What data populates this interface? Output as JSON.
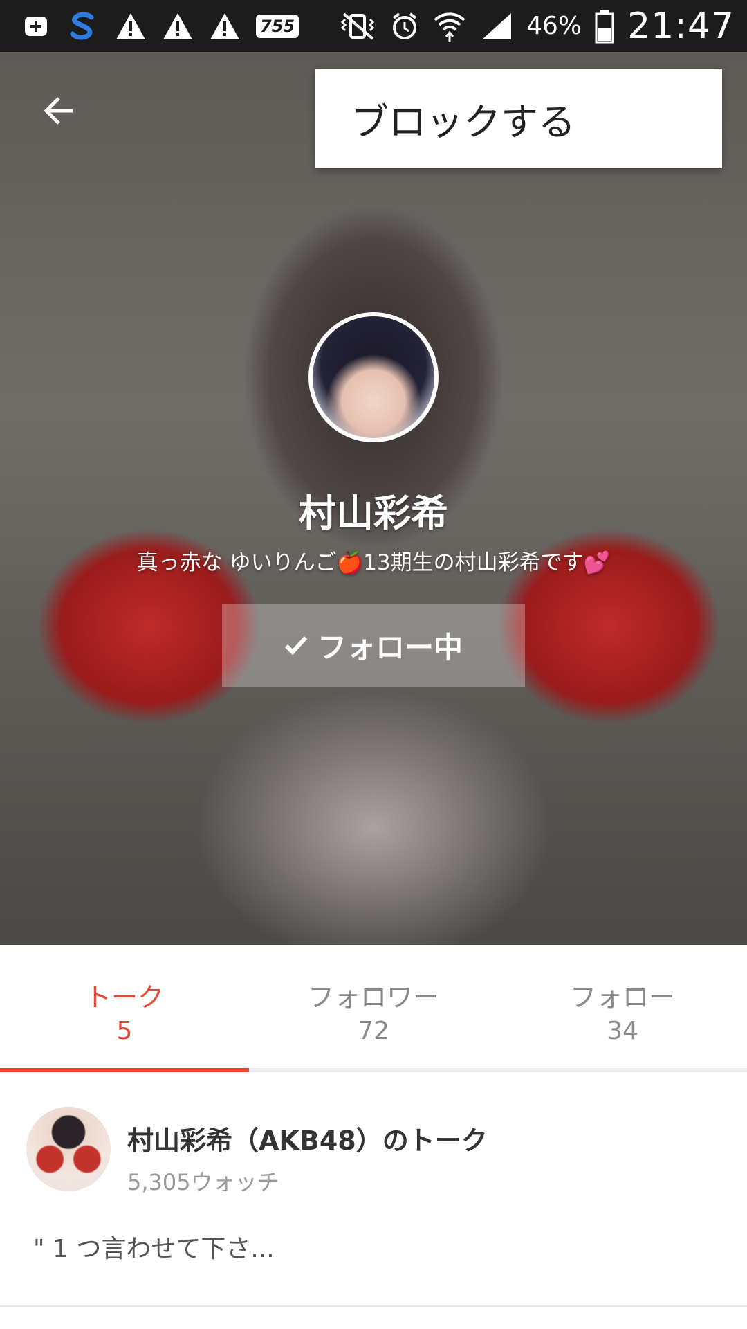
{
  "status_bar": {
    "left_icons": [
      "plus-badge-icon",
      "s-app-icon",
      "warning-icon",
      "warning-icon",
      "warning-icon",
      "app-box-icon"
    ],
    "app_box_label": "755",
    "right_icons": [
      "vibrate-icon",
      "alarm-icon",
      "wifi-icon",
      "signal-icon",
      "battery-icon"
    ],
    "battery": "46%",
    "time": "21:47"
  },
  "menu": {
    "items": [
      {
        "label": "ブロックする"
      }
    ]
  },
  "profile": {
    "name": "村山彩希",
    "bio": "真っ赤な ゆいりんご🍎13期生の村山彩希です💕",
    "follow_button_label": "フォロー中"
  },
  "tabs": [
    {
      "label": "トーク",
      "count": "5",
      "active": true
    },
    {
      "label": "フォロワー",
      "count": "72",
      "active": false
    },
    {
      "label": "フォロー",
      "count": "34",
      "active": false
    }
  ],
  "talk": {
    "title": "村山彩希（AKB48）のトーク",
    "watch_count": "5,305ウォッチ",
    "snippet": "\" 1 つ言わせて下さ..."
  },
  "colors": {
    "accent": "#e5493a",
    "status_bar": "#1c1c1c"
  }
}
